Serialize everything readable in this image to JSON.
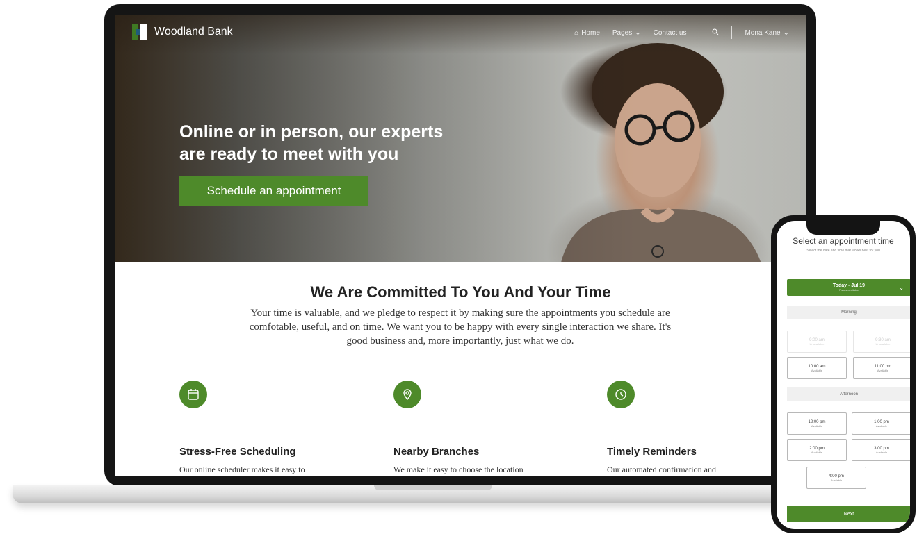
{
  "brand": {
    "name": "Woodland Bank",
    "accent": "#4e8a2a"
  },
  "nav": {
    "items": [
      {
        "label": "Home",
        "icon": "home-icon"
      },
      {
        "label": "Pages",
        "icon": "chevron-down-icon"
      },
      {
        "label": "Contact us"
      }
    ],
    "search_icon": "search-icon",
    "user": {
      "name": "Mona Kane",
      "icon": "chevron-down-icon"
    }
  },
  "hero": {
    "title_line1": "Online or in person, our experts",
    "title_line2": "are ready to meet with you",
    "cta_label": "Schedule an appointment"
  },
  "section": {
    "title": "We Are Committed To You And Your Time",
    "body": "Your time is valuable, and we pledge to respect it by making sure the appointments you schedule are comfotable, useful, and on time. We want you to be happy with every single interaction we share. It's good business and, more importantly, just what we do."
  },
  "features": [
    {
      "icon": "calendar-icon",
      "title": "Stress-Free Scheduling",
      "desc": "Our online scheduler makes it easy to get the meeting time"
    },
    {
      "icon": "location-pin-icon",
      "title": "Nearby Branches",
      "desc": "We make it easy to choose the location to meet that is"
    },
    {
      "icon": "clock-icon",
      "title": "Timely Reminders",
      "desc": "Our automated confirmation and reminder messages helps"
    }
  ],
  "phone": {
    "title": "Select an appointment time",
    "subtitle": "Select the date and time that works best for you",
    "date": {
      "label": "Today - Jul 19",
      "sub": "7 slots available"
    },
    "morning_label": "Morning",
    "morning_slots": [
      {
        "time": "9:00 am",
        "status": "Unavailable",
        "disabled": true
      },
      {
        "time": "9:30 am",
        "status": "Unavailable",
        "disabled": true
      },
      {
        "time": "10:00 am",
        "status": "Available",
        "disabled": false
      },
      {
        "time": "11:00 pm",
        "status": "Available",
        "disabled": false
      }
    ],
    "afternoon_label": "Afternoon",
    "afternoon_slots": [
      {
        "time": "12:00 pm",
        "status": "Available",
        "disabled": false
      },
      {
        "time": "1:00 pm",
        "status": "Available",
        "disabled": false
      },
      {
        "time": "2:00 pm",
        "status": "Available",
        "disabled": false
      },
      {
        "time": "3:00 pm",
        "status": "Available",
        "disabled": false
      },
      {
        "time": "4:00 pm",
        "status": "Available",
        "disabled": false
      }
    ],
    "next_label": "Next"
  }
}
